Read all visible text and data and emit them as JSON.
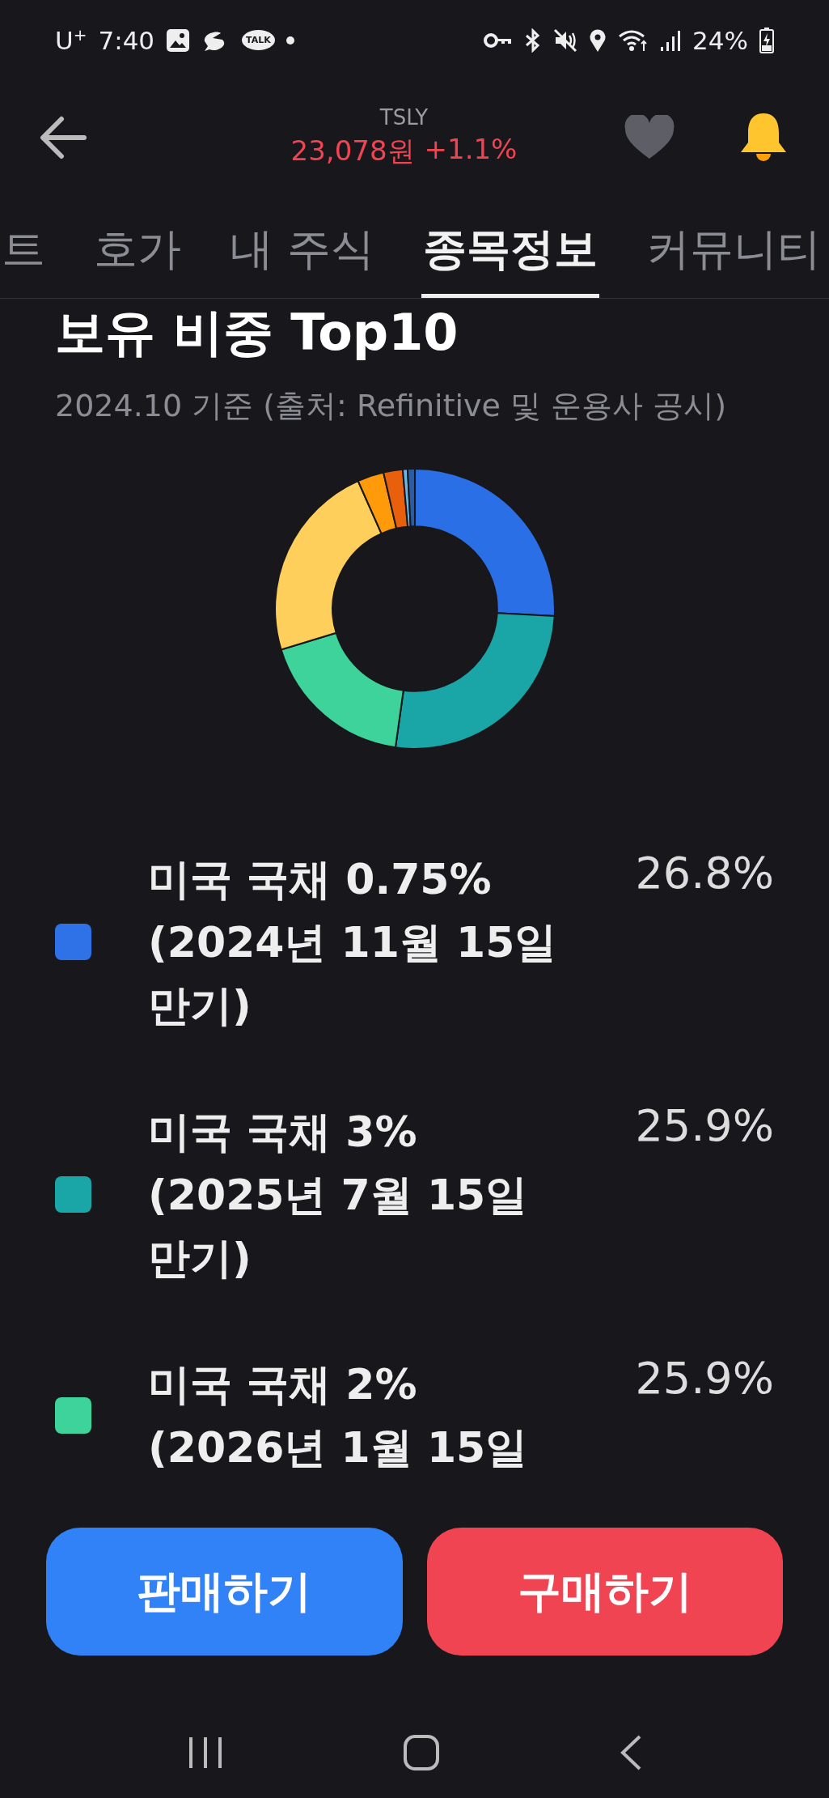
{
  "status_bar": {
    "carrier": "U",
    "carrier_mark": "+",
    "time": "7:40",
    "talk_label": "TALK",
    "battery": "24%"
  },
  "header": {
    "ticker": "TSLY",
    "price": "23,078원",
    "change": "+1.1%"
  },
  "tabs": [
    {
      "label": "트",
      "selected": false
    },
    {
      "label": "호가",
      "selected": false
    },
    {
      "label": "내 주식",
      "selected": false
    },
    {
      "label": "종목정보",
      "selected": true
    },
    {
      "label": "커뮤니티",
      "selected": false
    }
  ],
  "holdings": {
    "title": "보유 비중 Top10",
    "subtitle": "2024.10 기준 (출처: Refinitive 및 운용사 공시)",
    "items": [
      {
        "name": "미국 국채 0.75% (2024년 11월 15일 만기)",
        "value": "26.8%",
        "color": "#2f72e8"
      },
      {
        "name": "미국 국채 3% (2025년 7월 15일 만기)",
        "value": "25.9%",
        "color": "#1aa6a6"
      },
      {
        "name": "미국 국채 2% (2026년 1월 15일",
        "value": "25.9%",
        "color": "#3ed39a"
      }
    ]
  },
  "actions": [
    {
      "label": "판매하기",
      "kind": "sell"
    },
    {
      "label": "구매하기",
      "kind": "buy"
    }
  ]
}
